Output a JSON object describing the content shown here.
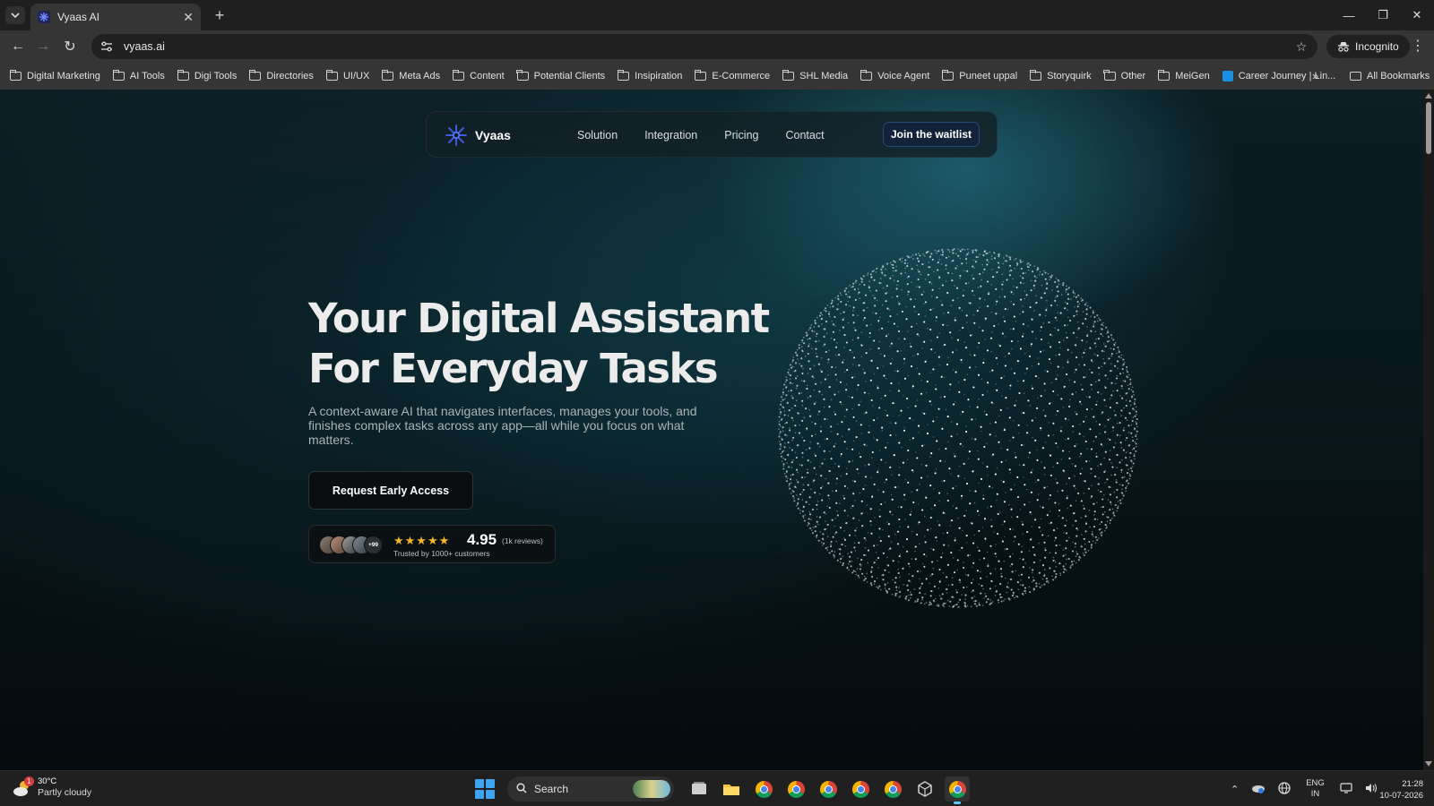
{
  "browser": {
    "tab_title": "Vyaas AI",
    "url": "vyaas.ai",
    "incognito_label": "Incognito",
    "bookmarks": [
      {
        "label": "Digital Marketing",
        "icon": "folder-icon"
      },
      {
        "label": "AI Tools",
        "icon": "folder-icon"
      },
      {
        "label": "Digi Tools",
        "icon": "folder-icon"
      },
      {
        "label": "Directories",
        "icon": "folder-icon"
      },
      {
        "label": "UI/UX",
        "icon": "folder-icon"
      },
      {
        "label": "Meta Ads",
        "icon": "folder-icon"
      },
      {
        "label": "Content",
        "icon": "folder-icon"
      },
      {
        "label": "Potential Clients",
        "icon": "folder-icon"
      },
      {
        "label": "Insipiration",
        "icon": "folder-icon"
      },
      {
        "label": "E-Commerce",
        "icon": "folder-icon"
      },
      {
        "label": "SHL Media",
        "icon": "folder-icon"
      },
      {
        "label": "Voice Agent",
        "icon": "folder-icon"
      },
      {
        "label": "Puneet uppal",
        "icon": "folder-icon"
      },
      {
        "label": "Storyquirk",
        "icon": "folder-icon"
      },
      {
        "label": "Other",
        "icon": "folder-icon"
      },
      {
        "label": "MeiGen",
        "icon": "folder-icon"
      },
      {
        "label": "Career Journey | Lin...",
        "icon": "link-icon"
      }
    ],
    "more_bookmarks": "»",
    "all_bookmarks": "All Bookmarks"
  },
  "site": {
    "brand": "Vyaas",
    "nav": [
      "Solution",
      "Integration",
      "Pricing",
      "Contact"
    ],
    "nav_cta": "Join the waitlist",
    "hero_title_line1": "Your Digital Assistant",
    "hero_title_line2": "For Everyday Tasks",
    "hero_subtitle": "A context-aware AI that navigates interfaces, manages your tools, and finishes complex tasks across any app—all while you focus on what matters.",
    "hero_cta": "Request Early Access",
    "avatar_count": "+99",
    "stars": 5,
    "rating": "4.95",
    "reviews": "(1k reviews)",
    "trusted": "Trusted by 1000+ customers",
    "accent_color": "#3b5bdb"
  },
  "taskbar": {
    "weather_temp": "30°C",
    "weather_cond": "Partly cloudy",
    "weather_badge": "1",
    "search_label": "Search",
    "lang_line1": "ENG",
    "lang_line2": "IN",
    "time": "21:28",
    "date": "10-07-2026"
  }
}
